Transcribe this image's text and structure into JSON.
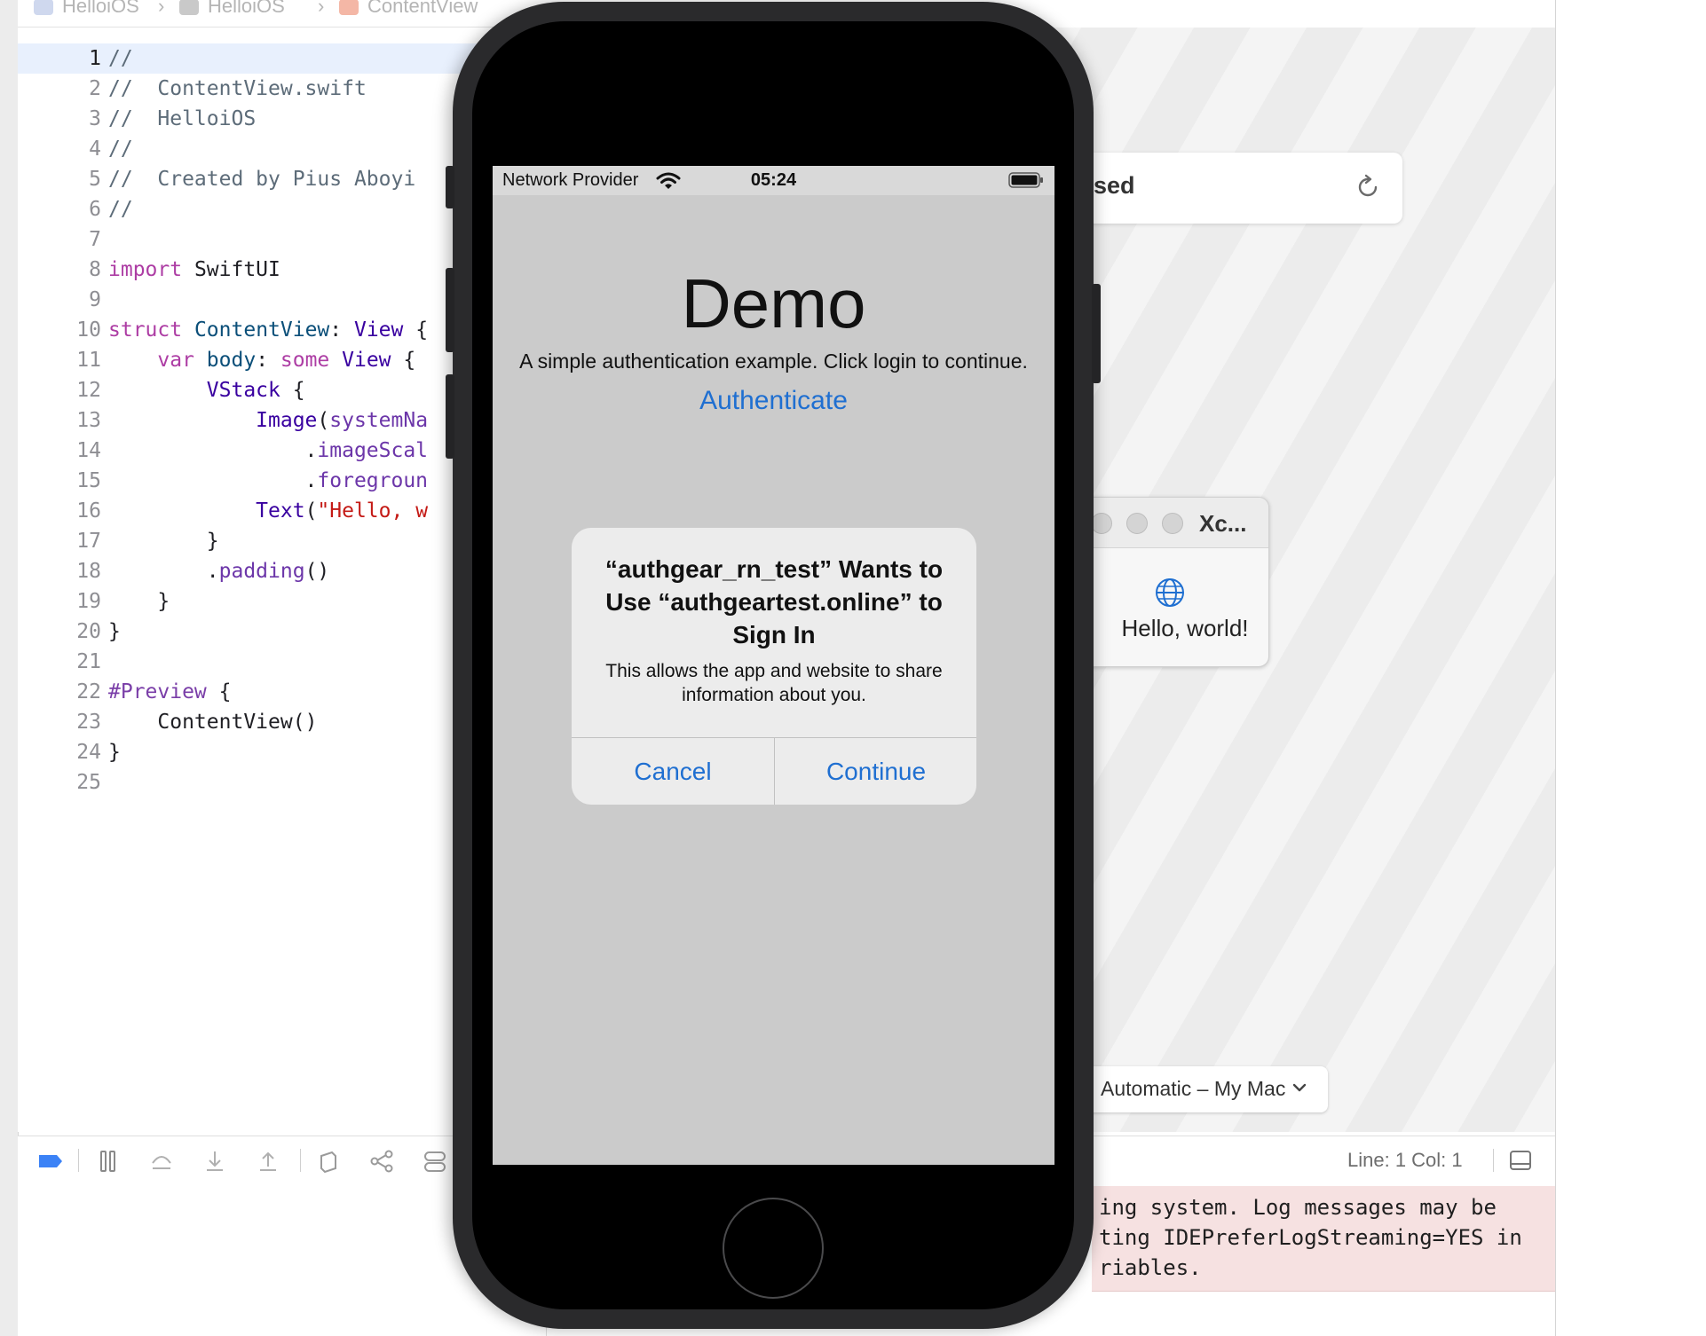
{
  "jumpbar": {
    "items": [
      "HelloiOS",
      "HelloiOS",
      "ContentView"
    ],
    "separator": "›"
  },
  "editor": {
    "lines": [
      {
        "n": "1",
        "html": "<span class='cm'>//</span>"
      },
      {
        "n": "2",
        "html": "<span class='cm'>//  ContentView.swift</span>"
      },
      {
        "n": "3",
        "html": "<span class='cm'>//  HelloiOS</span>"
      },
      {
        "n": "4",
        "html": "<span class='cm'>//</span>"
      },
      {
        "n": "5",
        "html": "<span class='cm'>//  Created by Pius Aboyi</span>"
      },
      {
        "n": "6",
        "html": "<span class='cm'>//</span>"
      },
      {
        "n": "7",
        "html": ""
      },
      {
        "n": "8",
        "html": "<span class='kw'>import</span> SwiftUI"
      },
      {
        "n": "9",
        "html": ""
      },
      {
        "n": "10",
        "html": "<span class='kw'>struct</span> <span class='ty'>ContentView</span>: <span class='tp'>View</span> {"
      },
      {
        "n": "11",
        "html": "    <span class='kw'>var</span> <span class='ty'>body</span>: <span class='kw'>some</span> <span class='tp'>View</span> {"
      },
      {
        "n": "12",
        "html": "        <span class='tp'>VStack</span> {"
      },
      {
        "n": "13",
        "html": "            <span class='tp'>Image</span>(<span class='fn'>systemNa</span>"
      },
      {
        "n": "14",
        "html": "                .<span class='fn'>imageScal</span>"
      },
      {
        "n": "15",
        "html": "                .<span class='fn'>foregroun</span>"
      },
      {
        "n": "16",
        "html": "            <span class='tp'>Text</span>(<span class='st'>\"Hello, w</span>"
      },
      {
        "n": "17",
        "html": "        }"
      },
      {
        "n": "18",
        "html": "        .<span class='fn'>padding</span>()"
      },
      {
        "n": "19",
        "html": "    }"
      },
      {
        "n": "20",
        "html": "}"
      },
      {
        "n": "21",
        "html": ""
      },
      {
        "n": "22",
        "html": "<span class='kw' style='color:#7a3ea8'>#Preview</span> {"
      },
      {
        "n": "23",
        "html": "    <span class='ty' style='color:#1f1f24'>ContentView</span>()"
      },
      {
        "n": "24",
        "html": "}"
      },
      {
        "n": "25",
        "html": ""
      }
    ],
    "current_line": "1"
  },
  "canvas": {
    "preview_status": "sed",
    "mini_window_title": "Xc...",
    "mini_window_text": "Hello, world!",
    "device_picker": "Automatic – My Mac"
  },
  "debug_bar": {
    "cursor_position": "Line: 1  Col: 1"
  },
  "console": {
    "lines": [
      "ing system. Log messages may be",
      "ting IDEPreferLogStreaming=YES in",
      "riables."
    ]
  },
  "simulator": {
    "status_bar": {
      "carrier": "Network Provider",
      "time": "05:24"
    },
    "app": {
      "title": "Demo",
      "subtitle": "A simple authentication example. Click login to continue.",
      "authenticate": "Authenticate"
    },
    "alert": {
      "title": "“authgear_rn_test” Wants to Use “authgeartest.online” to Sign In",
      "message": "This allows the app and website to share information about you.",
      "cancel": "Cancel",
      "continue": "Continue"
    }
  },
  "colors": {
    "accent": "#1f6fd1",
    "warning_bg": "#f6e1e1",
    "line_highlight": "#e8f0fd"
  }
}
